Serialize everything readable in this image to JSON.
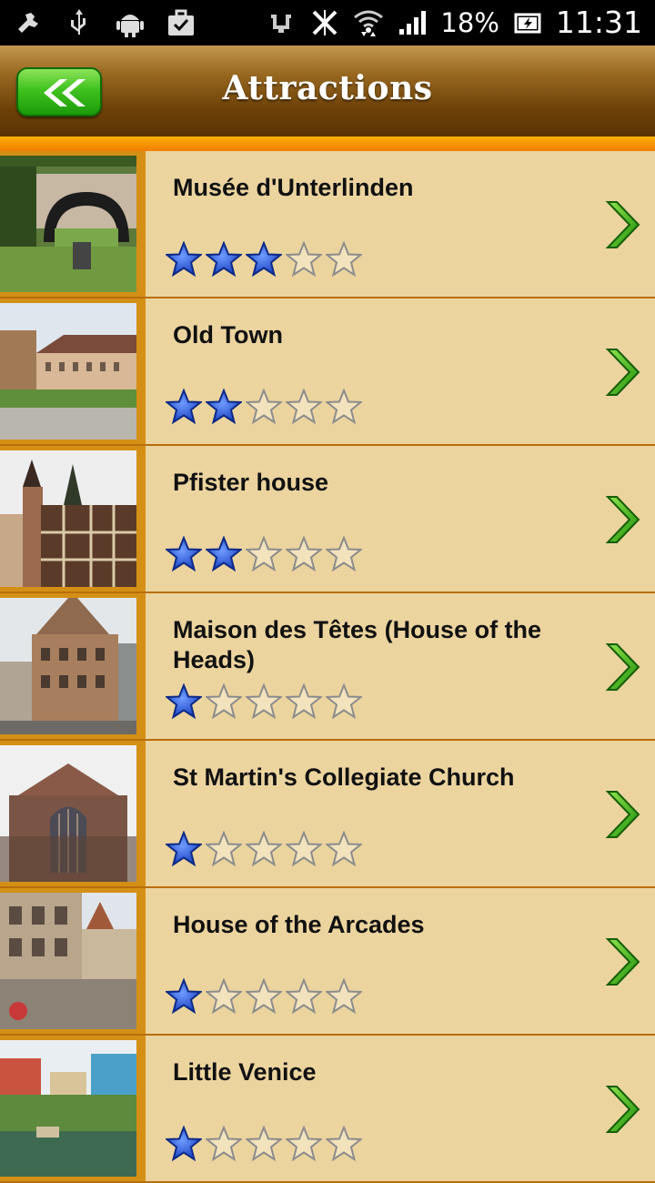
{
  "status_bar": {
    "icons": [
      "tools-icon",
      "usb-icon",
      "android-icon",
      "briefcase-icon",
      "vibrate-icon",
      "sync-off-icon",
      "wifi-icon",
      "signal-icon"
    ],
    "battery": "18%",
    "time": "11:31"
  },
  "header": {
    "title": "Attractions",
    "back_icon": "double-chevron-left-icon"
  },
  "colors": {
    "header_dark": "#5a3203",
    "row_bg": "#ecd49f",
    "accent_orange": "#f07d00",
    "star_filled": "#2f5ed6",
    "chevron_green": "#3fb81a"
  },
  "attractions": [
    {
      "name": "Musée d'Unterlinden",
      "rating": 3
    },
    {
      "name": "Old Town",
      "rating": 2
    },
    {
      "name": "Pfister house",
      "rating": 2
    },
    {
      "name": "Maison des Têtes (House of the Heads)",
      "rating": 1
    },
    {
      "name": "St Martin's Collegiate Church",
      "rating": 1
    },
    {
      "name": "House of the Arcades",
      "rating": 1
    },
    {
      "name": "Little Venice",
      "rating": 1
    }
  ]
}
